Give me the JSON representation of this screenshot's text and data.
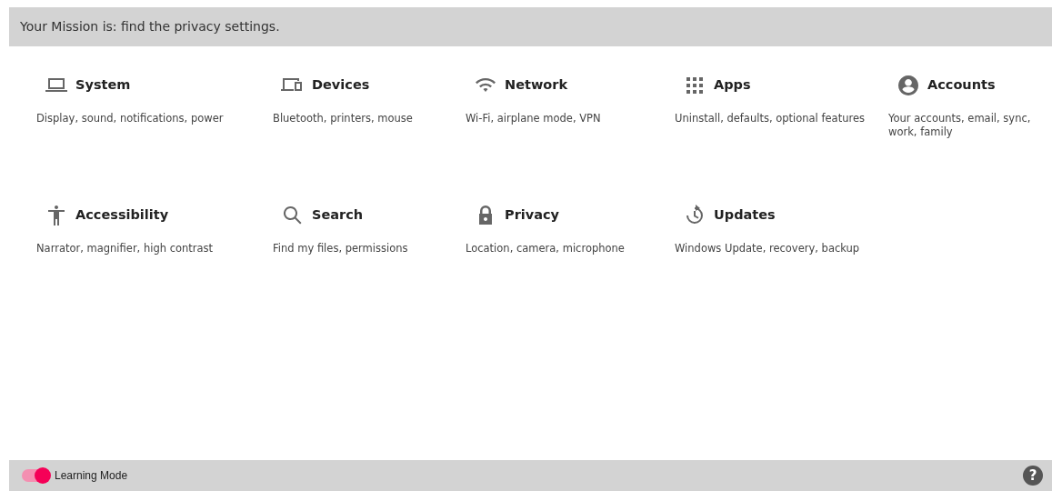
{
  "mission": "Your Mission is: find the privacy settings.",
  "categories": [
    {
      "kind": "laptop",
      "title": "System",
      "description": "Display, sound, notifications, power"
    },
    {
      "kind": "devices",
      "title": "Devices",
      "description": "Bluetooth, printers, mouse"
    },
    {
      "kind": "wifi",
      "title": "Network",
      "description": "Wi-Fi, airplane mode, VPN"
    },
    {
      "kind": "grid",
      "title": "Apps",
      "description": "Uninstall, defaults, optional features"
    },
    {
      "kind": "person",
      "title": "Accounts",
      "description": "Your accounts, email, sync, work, family"
    },
    {
      "kind": "figure",
      "title": "Accessibility",
      "description": "Narrator, magnifier, high contrast"
    },
    {
      "kind": "search",
      "title": "Search",
      "description": "Find my files, permissions"
    },
    {
      "kind": "lock",
      "title": "Privacy",
      "description": "Location, camera, microphone"
    },
    {
      "kind": "history",
      "title": "Updates",
      "description": "Windows Update, recovery, backup"
    }
  ],
  "footer": {
    "learning_mode": {
      "label": "Learning Mode",
      "on": true
    },
    "help": "?"
  }
}
